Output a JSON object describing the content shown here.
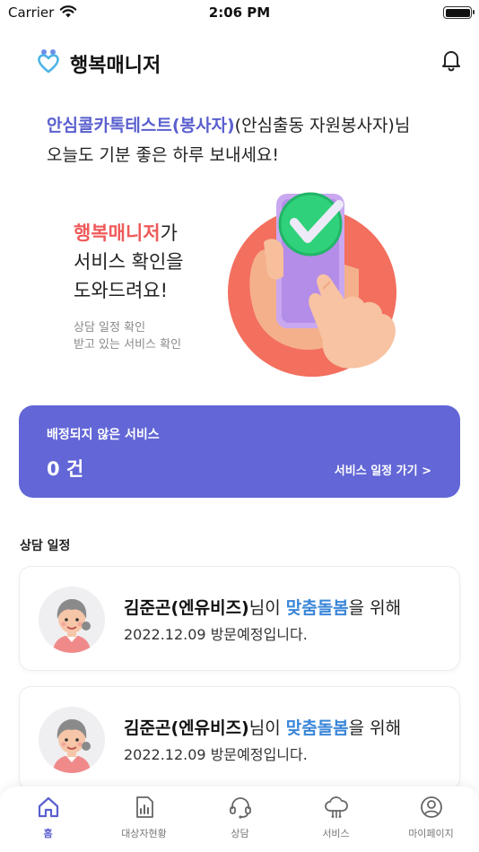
{
  "status_bar": {
    "carrier": "Carrier",
    "time": "2:06 PM"
  },
  "header": {
    "title": "행복매니저",
    "logo_icon": "heart-logo-icon",
    "bell_icon": "bell-icon"
  },
  "greeting": {
    "name": "안심콜카톡테스트(봉사자)",
    "role": "(안심출동 자원봉사자)님",
    "message": "오늘도 기분 좋은 하루 보내세요!"
  },
  "hero": {
    "accent": "행복매니저",
    "accent_suffix": "가",
    "line2": "서비스 확인을",
    "line3": "도와드려요!",
    "sub1": "상담 일정 확인",
    "sub2": "받고 있는 서비스 확인"
  },
  "unassigned": {
    "label": "배정되지 않은 서비스",
    "count": "0 건",
    "link": "서비스 일정 가기 >"
  },
  "schedule_section": {
    "title": "상담 일정",
    "items": [
      {
        "name": "김준곤(엔유비즈)",
        "mid": "님이 ",
        "service": "맞춤돌봄",
        "tail": "을 위해",
        "date_text": "2022.12.09 방문예정입니다."
      },
      {
        "name": "김준곤(엔유비즈)",
        "mid": "님이 ",
        "service": "맞춤돌봄",
        "tail": "을 위해",
        "date_text": "2022.12.09 방문예정입니다."
      }
    ]
  },
  "tab_bar": {
    "active": "홈",
    "tabs": [
      {
        "label": "홈",
        "icon": "home-icon"
      },
      {
        "label": "대상자현황",
        "icon": "chart-icon"
      },
      {
        "label": "상담",
        "icon": "headset-icon"
      },
      {
        "label": "서비스",
        "icon": "cloud-icon"
      },
      {
        "label": "마이페이지",
        "icon": "user-icon"
      }
    ]
  },
  "colors": {
    "primary": "#6266D6",
    "accent_red": "#EF5A5A",
    "service_blue": "#3A86D8"
  }
}
